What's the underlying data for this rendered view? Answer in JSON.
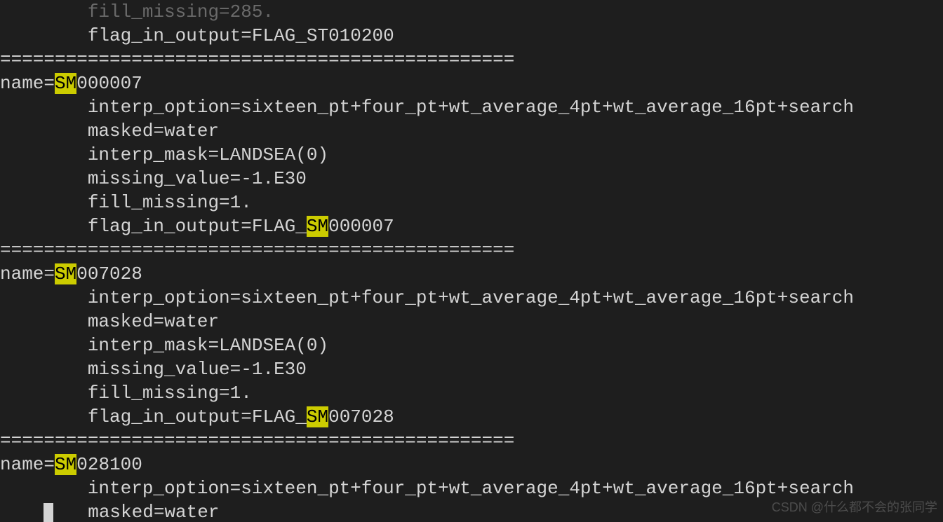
{
  "lines": {
    "l0": "        fill_missing=285.",
    "l1": "        flag_in_output=FLAG_ST010200",
    "sep1": "===============================================",
    "name1_prefix": "name=",
    "name1_hl": "SM",
    "name1_suffix": "000007",
    "l2": "        interp_option=sixteen_pt+four_pt+wt_average_4pt+wt_average_16pt+search",
    "l3": "        masked=water",
    "l4": "        interp_mask=LANDSEA(0)",
    "l5": "        missing_value=-1.E30",
    "l6": "        fill_missing=1.",
    "flag1_prefix": "        flag_in_output=FLAG_",
    "flag1_hl": "SM",
    "flag1_suffix": "000007",
    "sep2": "===============================================",
    "name2_prefix": "name=",
    "name2_hl": "SM",
    "name2_suffix": "007028",
    "l7": "        interp_option=sixteen_pt+four_pt+wt_average_4pt+wt_average_16pt+search",
    "l8": "        masked=water",
    "l9": "        interp_mask=LANDSEA(0)",
    "l10": "        missing_value=-1.E30",
    "l11": "        fill_missing=1.",
    "flag2_prefix": "        flag_in_output=FLAG_",
    "flag2_hl": "SM",
    "flag2_suffix": "007028",
    "sep3": "===============================================",
    "name3_prefix": "name=",
    "name3_hl": "SM",
    "name3_suffix": "028100",
    "l12": "        interp_option=sixteen_pt+four_pt+wt_average_4pt+wt_average_16pt+search",
    "l13_prefix": "    ",
    "l13_suffix": "   masked=water"
  },
  "watermark": "CSDN @什么都不会的张同学"
}
